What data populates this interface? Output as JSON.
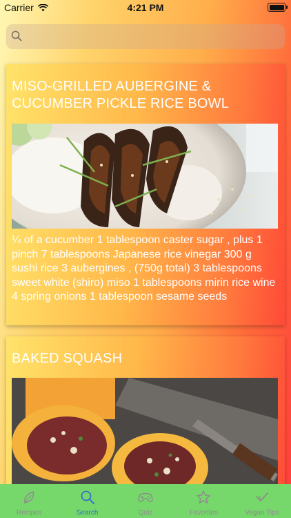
{
  "status_bar": {
    "carrier": "Carrier",
    "time": "4:21 PM"
  },
  "search": {
    "placeholder": ""
  },
  "recipes": [
    {
      "title": "MISO-GRILLED AUBERGINE & CUCUMBER PICKLE RICE BOWL",
      "ingredients": "¼ of a cucumber  1 tablespoon caster sugar , plus 1 pinch  7 tablespoons Japanese rice vinegar  300 g sushi rice  3 aubergines , (750g total)  3 tablespoons sweet white (shiro) miso  1 tablespoons mirin rice wine  4 spring onions  1 tablespoon sesame seeds"
    },
    {
      "title": "BAKED SQUASH"
    }
  ],
  "tabbar": {
    "tabs": [
      {
        "label": "Recipes",
        "icon": "leaf-icon"
      },
      {
        "label": "Search",
        "icon": "search-icon",
        "active": true
      },
      {
        "label": "Quiz",
        "icon": "gamepad-icon"
      },
      {
        "label": "Favorites",
        "icon": "star-icon"
      },
      {
        "label": "Vegan Tips",
        "icon": "checkmark-icon"
      }
    ]
  },
  "colors": {
    "tab_active": "#3a6fc9",
    "tab_inactive": "#8d8d8d",
    "tabbar_bg": "#76d86a"
  }
}
